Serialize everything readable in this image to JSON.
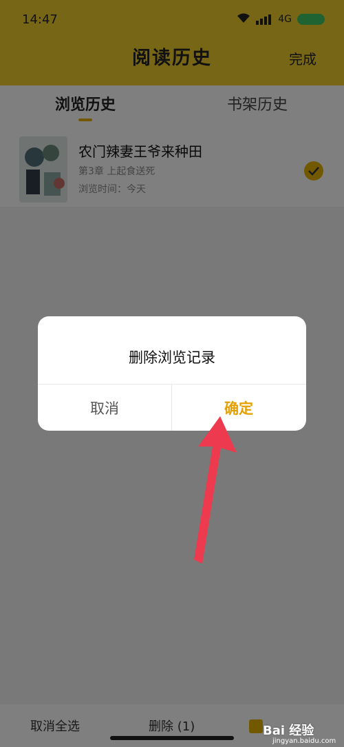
{
  "status_bar": {
    "time": "14:47",
    "network": "4G"
  },
  "header": {
    "title": "阅读历史",
    "done_label": "完成"
  },
  "tabs": [
    {
      "label": "浏览历史",
      "active": true
    },
    {
      "label": "书架历史",
      "active": false
    }
  ],
  "list": {
    "items": [
      {
        "title": "农门辣妻王爷来种田",
        "sub1": "第3章 上起食送死",
        "sub2": "浏览时间：今天"
      }
    ]
  },
  "bottom_bar": {
    "left_label": "取消全选",
    "middle_label": "删除 (1)"
  },
  "dialog": {
    "title": "删除浏览记录",
    "cancel": "取消",
    "confirm": "确定"
  },
  "watermark": {
    "brand": "Bai 经验",
    "domain": "jingyan.baidu.com"
  },
  "colors": {
    "accent": "#f1cc2f",
    "confirm": "#e5a000",
    "arrow": "#ee3a4f"
  }
}
